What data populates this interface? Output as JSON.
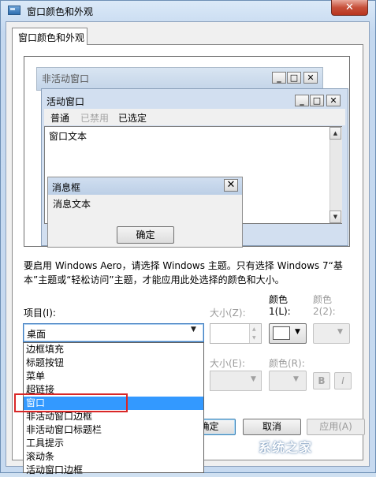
{
  "window": {
    "title": "窗口颜色和外观",
    "close_glyph": "✕"
  },
  "tab": {
    "label": "窗口颜色和外观"
  },
  "preview": {
    "inactive_title": "非活动窗口",
    "active_title": "活动窗口",
    "menu": [
      "普通",
      "已禁用",
      "已选定"
    ],
    "window_text": "窗口文本",
    "msgbox_title": "消息框",
    "msgbox_text": "消息文本",
    "msgbox_ok": "确定",
    "caption_glyphs": {
      "minimize": "_",
      "maximize": "□",
      "close": "✕"
    }
  },
  "info": "要启用 Windows Aero，请选择 Windows 主题。只有选择 Windows 7“基本”主题或“轻松访问”主题，才能应用此处选择的颜色和大小。",
  "labels": {
    "item": "项目(I):",
    "size_z": "大小(Z):",
    "color1_a": "颜色",
    "color1_b": "1(L):",
    "color2_a": "颜色",
    "color2_b": "2(2):",
    "font_size": "大小(E):",
    "font_color": "颜色(R):"
  },
  "item_combo": {
    "value": "桌面"
  },
  "format": {
    "bold": "B",
    "italic": "I"
  },
  "buttons": {
    "ok": "确定",
    "cancel": "取消",
    "apply": "应用(A)"
  },
  "dropdown_items": [
    "边框填充",
    "标题按钮",
    "菜单",
    "超链接",
    "窗口",
    "非活动窗口边框",
    "非活动窗口标题栏",
    "工具提示",
    "滚动条",
    "活动窗口边框"
  ],
  "dropdown_selected_index": 4,
  "colors": {
    "selection": "#3399ff",
    "highlight_box": "#d92727",
    "close_button": "#c7503a"
  },
  "watermark": "系统之家"
}
